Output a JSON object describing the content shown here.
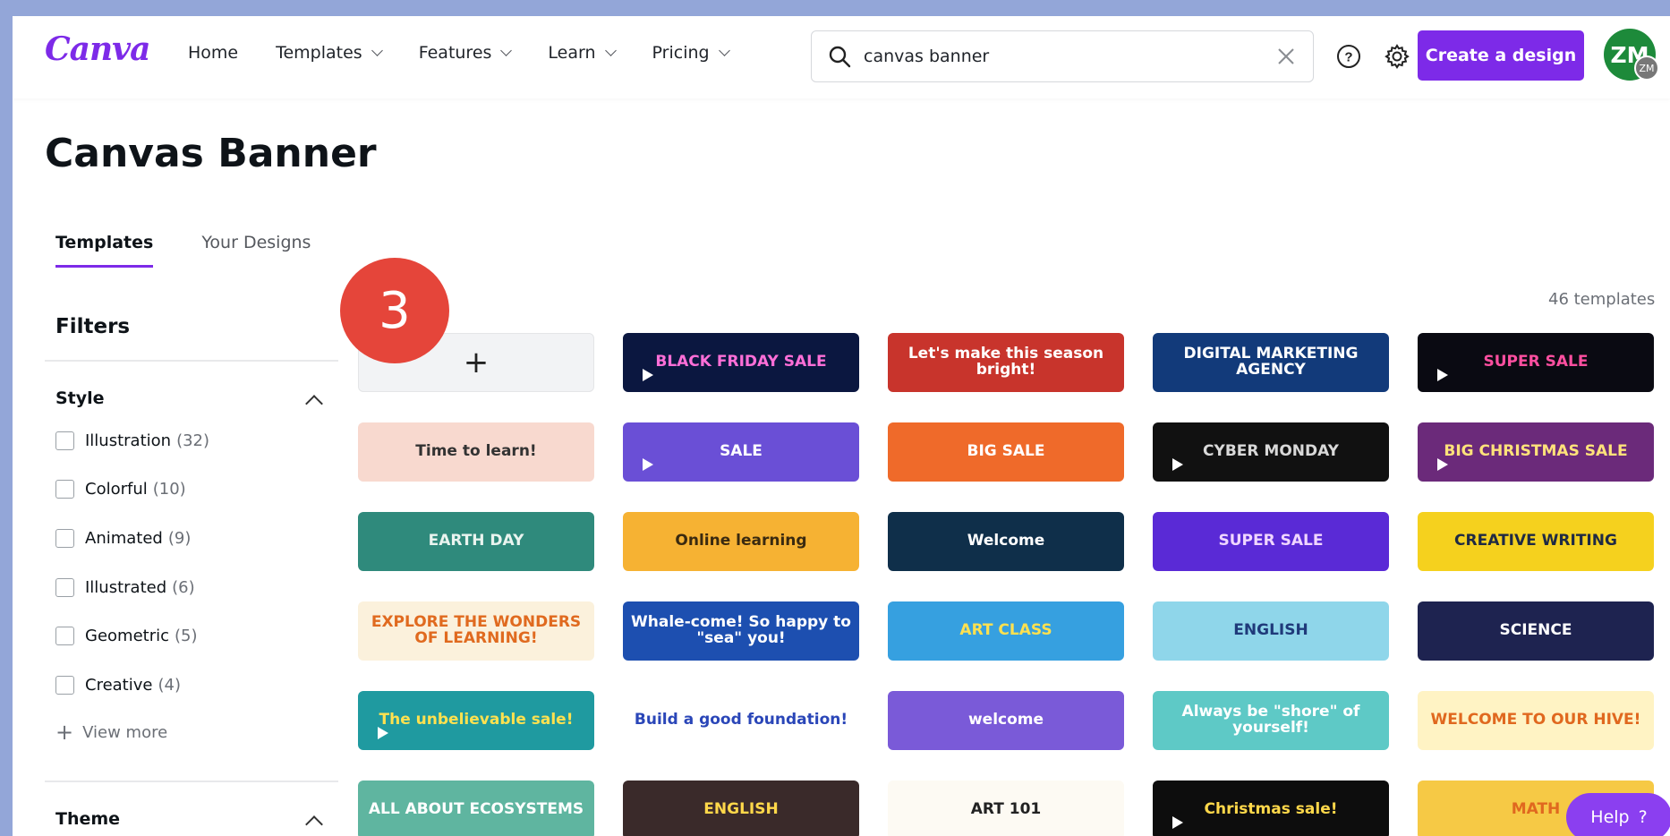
{
  "nav": {
    "logo": "Canva",
    "menu": [
      {
        "label": "Home",
        "has_dropdown": false
      },
      {
        "label": "Templates",
        "has_dropdown": true
      },
      {
        "label": "Features",
        "has_dropdown": true
      },
      {
        "label": "Learn",
        "has_dropdown": true
      },
      {
        "label": "Pricing",
        "has_dropdown": true
      }
    ],
    "search_value": "canvas banner",
    "create_label": "Create a design",
    "avatar_initials": "ZM",
    "avatar_sub": "ZM",
    "brand_color": "#7d2ae8"
  },
  "page": {
    "title": "Canvas Banner",
    "tabs": [
      "Templates",
      "Your Designs"
    ],
    "active_tab": "Templates",
    "template_count": "46 templates",
    "step_badge": "3"
  },
  "sidebar": {
    "filters_title": "Filters",
    "style_title": "Style",
    "style_options": [
      {
        "label": "Illustration",
        "count": "(32)"
      },
      {
        "label": "Colorful",
        "count": "(10)"
      },
      {
        "label": "Animated",
        "count": "(9)"
      },
      {
        "label": "Illustrated",
        "count": "(6)"
      },
      {
        "label": "Geometric",
        "count": "(5)"
      },
      {
        "label": "Creative",
        "count": "(4)"
      }
    ],
    "view_more": "View more",
    "theme_title": "Theme"
  },
  "templates": [
    {
      "text": "+",
      "bg": "#f2f3f5",
      "fg": "#222222",
      "video": false
    },
    {
      "text": "BLACK FRIDAY SALE",
      "bg": "#0b1740",
      "fg": "#ff6fd8",
      "video": true
    },
    {
      "text": "Let's make this season bright!",
      "bg": "#c8342c",
      "fg": "#ffffff",
      "video": false
    },
    {
      "text": "DIGITAL MARKETING AGENCY",
      "bg": "#123a7a",
      "fg": "#ffffff",
      "video": false
    },
    {
      "text": "SUPER SALE",
      "bg": "#0a0a12",
      "fg": "#ff4fa0",
      "video": true
    },
    {
      "text": "Time to learn!",
      "bg": "#f8d9cf",
      "fg": "#333333",
      "video": false
    },
    {
      "text": "SALE",
      "bg": "#6a4fd6",
      "fg": "#ffffff",
      "video": true
    },
    {
      "text": "BIG SALE",
      "bg": "#ef6a2a",
      "fg": "#ffffff",
      "video": false
    },
    {
      "text": "CYBER MONDAY",
      "bg": "#111111",
      "fg": "#d9d9d9",
      "video": true
    },
    {
      "text": "BIG CHRISTMAS SALE",
      "bg": "#6b2a7a",
      "fg": "#ffe27a",
      "video": true
    },
    {
      "text": "EARTH DAY",
      "bg": "#2f8a7c",
      "fg": "#e9f4ef",
      "video": false
    },
    {
      "text": "Online learning",
      "bg": "#f6b233",
      "fg": "#3a2a10",
      "video": false
    },
    {
      "text": "Welcome",
      "bg": "#0f2f4a",
      "fg": "#ffffff",
      "video": false
    },
    {
      "text": "SUPER SALE",
      "bg": "#5a2ad6",
      "fg": "#f0d6ff",
      "video": false
    },
    {
      "text": "CREATIVE WRITING",
      "bg": "#f5d11e",
      "fg": "#1f2a44",
      "video": false
    },
    {
      "text": "EXPLORE THE WONDERS OF LEARNING!",
      "bg": "#fbf1dc",
      "fg": "#e06a1f",
      "video": false
    },
    {
      "text": "Whale-come! So happy to \"sea\" you!",
      "bg": "#1d4fb0",
      "fg": "#ffffff",
      "video": false
    },
    {
      "text": "ART CLASS",
      "bg": "#36a0e0",
      "fg": "#ffe14f",
      "video": false
    },
    {
      "text": "ENGLISH",
      "bg": "#8fd6ea",
      "fg": "#1f3a7a",
      "video": false
    },
    {
      "text": "SCIENCE",
      "bg": "#1e2350",
      "fg": "#ffffff",
      "video": false
    },
    {
      "text": "The unbelievable sale!",
      "bg": "#1f9aa0",
      "fg": "#ffe14f",
      "video": true
    },
    {
      "text": "Build a good foundation!",
      "bg": "#ffffff",
      "fg": "#2a46b8",
      "video": false
    },
    {
      "text": "welcome",
      "bg": "#7a5ad8",
      "fg": "#ffffff",
      "video": false
    },
    {
      "text": "Always be \"shore\" of yourself!",
      "bg": "#5ec9c6",
      "fg": "#ffffff",
      "video": false
    },
    {
      "text": "WELCOME TO OUR HIVE!",
      "bg": "#fff3c4",
      "fg": "#e0681f",
      "video": false
    },
    {
      "text": "ALL ABOUT ECOSYSTEMS",
      "bg": "#5fb5a0",
      "fg": "#ffffff",
      "video": false
    },
    {
      "text": "ENGLISH",
      "bg": "#3a2a2a",
      "fg": "#ffd84a",
      "video": false
    },
    {
      "text": "ART 101",
      "bg": "#fdfaf3",
      "fg": "#222222",
      "video": false
    },
    {
      "text": "Christmas sale!",
      "bg": "#0d0d0d",
      "fg": "#ffd84a",
      "video": true
    },
    {
      "text": "MATH",
      "bg": "#f6c945",
      "fg": "#e0681f",
      "video": false
    }
  ],
  "help": {
    "label": "Help",
    "glyph": "?"
  }
}
